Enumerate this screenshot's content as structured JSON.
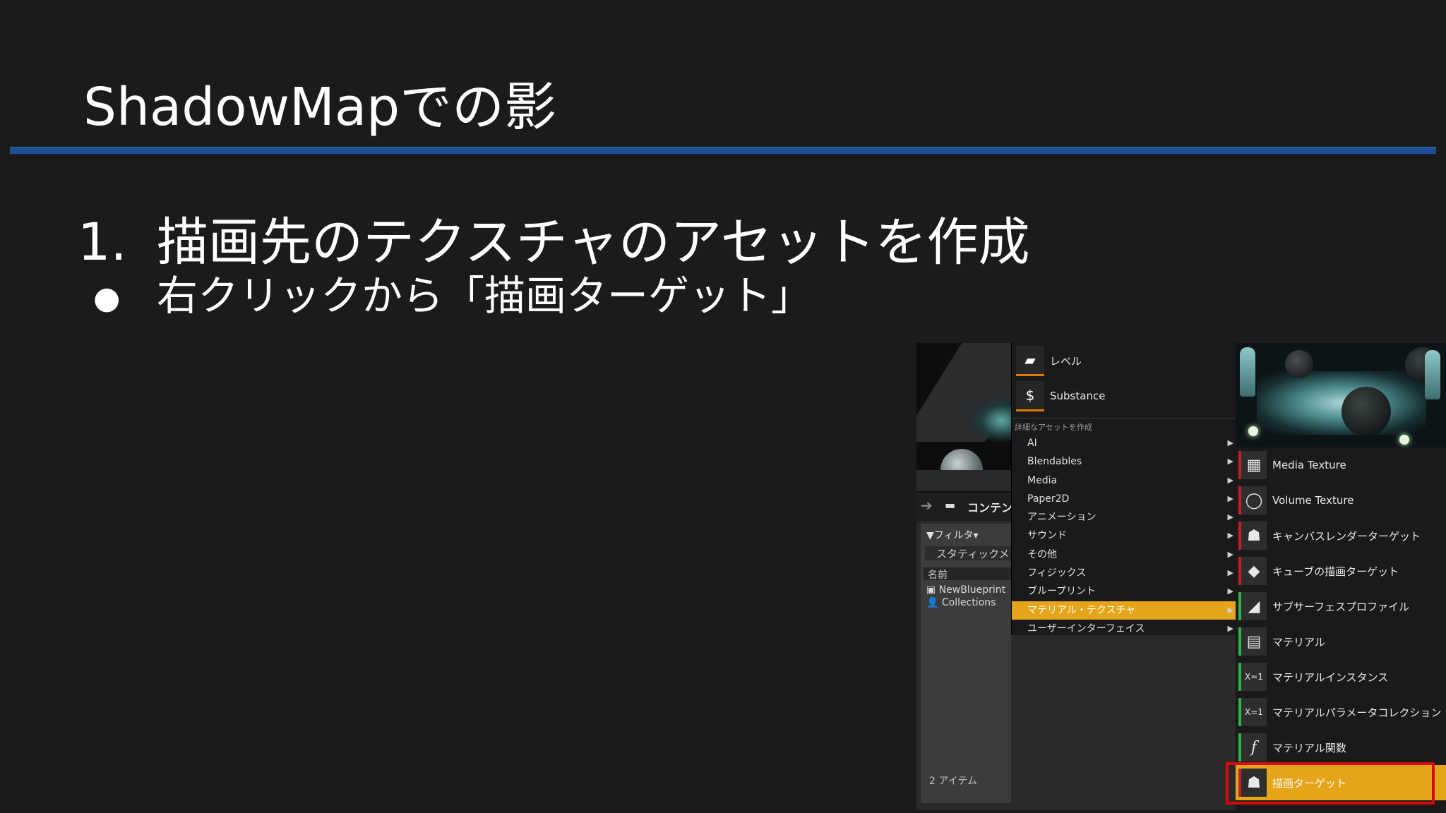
{
  "slide": {
    "title": "ShadowMapでの影",
    "heading_num": "1.",
    "heading": "描画先のテクスチャのアセットを作成",
    "bullet": "●",
    "bullet_text": "右クリックから「描画ターゲット」"
  },
  "content_browser": {
    "header": "コンテン",
    "filter": "▼フィルタ▾",
    "static_mesh": "スタティックメ",
    "name_col": "名前",
    "items": [
      "NewBlueprint",
      "Collections"
    ],
    "count": "2 アイテム"
  },
  "context_menu": {
    "top_items": [
      {
        "label": "レベル",
        "icon": "level-icon"
      },
      {
        "label": "Substance",
        "icon": "substance-icon"
      }
    ],
    "section": "詳細なアセットを作成",
    "items": [
      {
        "label": "AI"
      },
      {
        "label": "Blendables"
      },
      {
        "label": "Media"
      },
      {
        "label": "Paper2D"
      },
      {
        "label": "アニメーション"
      },
      {
        "label": "サウンド"
      },
      {
        "label": "その他"
      },
      {
        "label": "フィジックス"
      },
      {
        "label": "ブループリント"
      },
      {
        "label": "マテリアル・テクスチャ",
        "selected": true
      },
      {
        "label": "ユーザーインターフェイス"
      }
    ]
  },
  "submenu": {
    "items": [
      {
        "label": "Media Texture",
        "icon": "media-texture-icon",
        "accent": "#c0202a"
      },
      {
        "label": "Volume Texture",
        "icon": "volume-texture-icon",
        "accent": "#c0202a"
      },
      {
        "label": "キャンバスレンダーターゲット",
        "icon": "canvas-render-target-icon",
        "accent": "#c0202a"
      },
      {
        "label": "キューブの描画ターゲット",
        "icon": "cube-render-target-icon",
        "accent": "#c0202a"
      },
      {
        "label": "サブサーフェスプロファイル",
        "icon": "subsurface-profile-icon",
        "accent": "#2db34a"
      },
      {
        "label": "マテリアル",
        "icon": "material-icon",
        "accent": "#2db34a"
      },
      {
        "label": "マテリアルインスタンス",
        "icon": "material-instance-icon",
        "accent": "#2db34a"
      },
      {
        "label": "マテリアルパラメータコレクション",
        "icon": "material-parameter-collection-icon",
        "accent": "#2db34a"
      },
      {
        "label": "マテリアル関数",
        "icon": "material-function-icon",
        "accent": "#2db34a"
      },
      {
        "label": "描画ターゲット",
        "icon": "render-target-icon",
        "accent": "#c0202a",
        "highlight": true
      }
    ]
  },
  "colors": {
    "background": "#1b1b1c",
    "title_rule": "#1f4f93",
    "menu_highlight": "#e5a51a",
    "callout_border": "#d80a0a"
  }
}
